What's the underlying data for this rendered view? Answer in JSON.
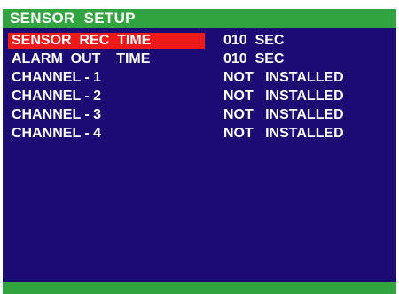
{
  "menu": {
    "title": "SENSOR  SETUP",
    "colors": {
      "background": "#1c0b73",
      "bar": "#31a43f",
      "highlight": "#ee1a1a",
      "text": "#ffffff"
    },
    "items": [
      {
        "label": "SENSOR  REC  TIME",
        "value": "010  SEC",
        "selected": true
      },
      {
        "label": "ALARM  OUT    TIME",
        "value": "010  SEC",
        "selected": false
      },
      {
        "label": "CHANNEL - 1",
        "value": "NOT   INSTALLED",
        "selected": false
      },
      {
        "label": "CHANNEL - 2",
        "value": "NOT   INSTALLED",
        "selected": false
      },
      {
        "label": "CHANNEL - 3",
        "value": "NOT   INSTALLED",
        "selected": false
      },
      {
        "label": "CHANNEL - 4",
        "value": "NOT   INSTALLED",
        "selected": false
      }
    ]
  }
}
